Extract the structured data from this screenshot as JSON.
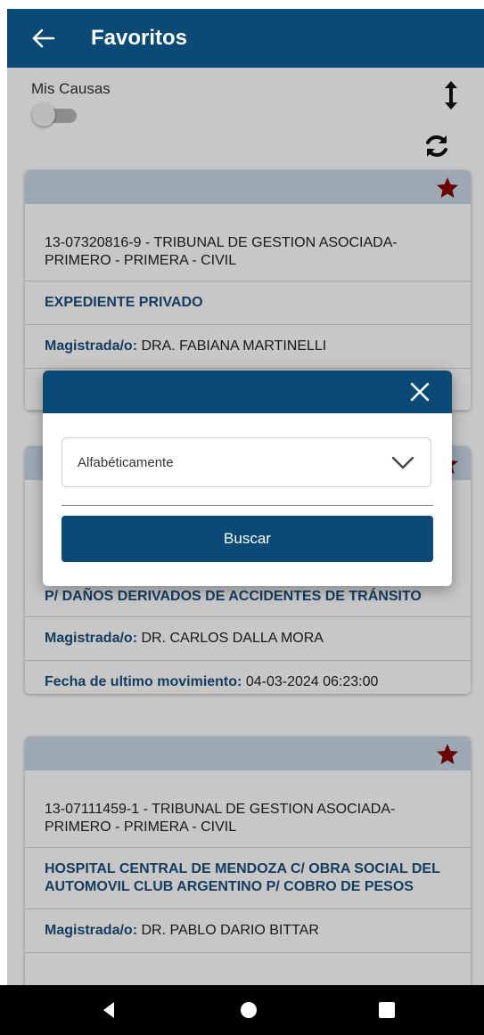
{
  "topbar": {
    "title": "Favoritos",
    "back_icon": "arrow-left-icon"
  },
  "filters": {
    "mis_causas_label": "Mis Causas",
    "mis_causas_enabled": false,
    "sort_icon": "sort-vertical-icon",
    "refresh_icon": "refresh-icon"
  },
  "cards": [
    {
      "code": "13-07320816-9 - TRIBUNAL DE GESTION ASOCIADA-PRIMERO - PRIMERA - CIVIL",
      "title": "EXPEDIENTE PRIVADO",
      "magistrado_label": "Magistrada/o:",
      "magistrado": "DRA. FABIANA MARTINELLI",
      "favorite": true
    },
    {
      "title": "P/ DAÑOS DERIVADOS DE ACCIDENTES DE TRÁNSITO",
      "magistrado_label": "Magistrada/o:",
      "magistrado": "DR. CARLOS DALLA MORA",
      "fecha_label": "Fecha de ultimo movimiento:",
      "fecha": "04-03-2024 06:23:00",
      "favorite": true
    },
    {
      "code": "13-07111459-1 - TRIBUNAL DE GESTION ASOCIADA-PRIMERO - PRIMERA - CIVIL",
      "title": "HOSPITAL CENTRAL DE MENDOZA C/ OBRA SOCIAL DEL AUTOMOVIL CLUB ARGENTINO P/ COBRO DE PESOS",
      "magistrado_label": "Magistrada/o:",
      "magistrado": "DR. PABLO DARIO BITTAR",
      "favorite": true
    }
  ],
  "modal": {
    "close_icon": "close-icon",
    "select_value": "Alfabéticamente",
    "button_label": "Buscar"
  },
  "colors": {
    "primary": "#0b4a77",
    "card_header": "#c8d9e6",
    "star": "#8b0000",
    "label_blue": "#1b4f7c"
  }
}
